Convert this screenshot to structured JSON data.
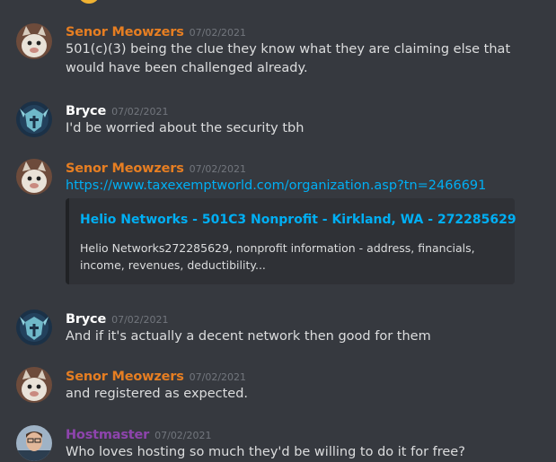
{
  "messages": [
    {
      "author": "Senor Meowzers",
      "author_color": "#e67e22",
      "timestamp": "07/02/2021",
      "avatar_icon": "cat-avatar-icon",
      "text": "501(c)(3) being the clue they know what they are claiming else that would have been challenged already."
    },
    {
      "author": "Bryce",
      "author_color": "#ffffff",
      "timestamp": "07/02/2021",
      "avatar_icon": "helmet-avatar-icon",
      "text": "I'd be worried about the security tbh"
    },
    {
      "author": "Senor Meowzers",
      "author_color": "#e67e22",
      "timestamp": "07/02/2021",
      "avatar_icon": "cat-avatar-icon",
      "link": "https://www.taxexemptworld.com/organization.asp?tn=2466691",
      "embed": {
        "title": "Helio Networks - 501C3 Nonprofit - Kirkland, WA - 272285629",
        "description": "Helio Networks272285629, nonprofit information - address, financials, income, revenues, deductibility..."
      }
    },
    {
      "author": "Bryce",
      "author_color": "#ffffff",
      "timestamp": "07/02/2021",
      "avatar_icon": "helmet-avatar-icon",
      "text": "And if it's actually a decent network then good for them"
    },
    {
      "author": "Senor Meowzers",
      "author_color": "#e67e22",
      "timestamp": "07/02/2021",
      "avatar_icon": "cat-avatar-icon",
      "text": "and registered as expected."
    },
    {
      "author": "Hostmaster",
      "author_color": "#8e44ad",
      "timestamp": "07/02/2021",
      "avatar_icon": "person-avatar-icon",
      "text": "Who loves hosting so much they'd be willing to do it for free?"
    }
  ]
}
